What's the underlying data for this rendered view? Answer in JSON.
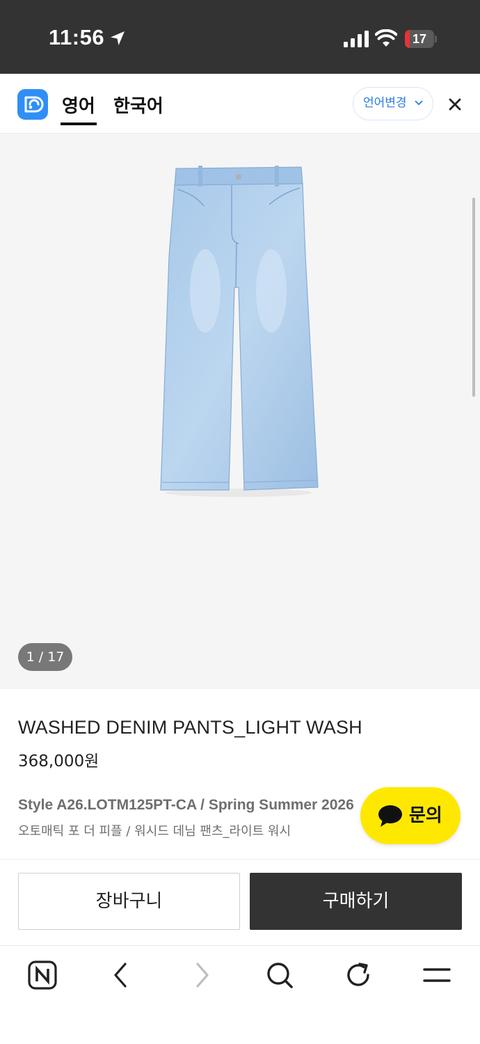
{
  "status_bar": {
    "time": "11:56",
    "battery_level": "17",
    "battery_fraction": 0.17,
    "battery_color": "#e5333b",
    "icons": [
      "location-arrow-icon",
      "cellular-signal-icon",
      "wifi-icon",
      "battery-icon"
    ]
  },
  "translate_bar": {
    "tabs": [
      {
        "label": "영어",
        "active": true
      },
      {
        "label": "한국어",
        "active": false
      }
    ],
    "change_language_label": "언어변경",
    "accent_color": "#2c7be5",
    "icons": [
      "translate-app-logo-icon",
      "chevron-down-icon",
      "close-icon"
    ]
  },
  "gallery": {
    "counter": "1 / 17",
    "current": 1,
    "total": 17
  },
  "product": {
    "name": "WASHED DENIM PANTS_LIGHT WASH",
    "price": "368,000원",
    "style_line": "Style A26.LOTM125PT-CA / Spring Summer 2026",
    "korean_name": "오토매틱 포 더 피플 / 워시드 데님 팬츠_라이트 워시"
  },
  "inquiry": {
    "label": "문의",
    "color": "#ffe800"
  },
  "actions": {
    "cart_label": "장바구니",
    "buy_label": "구매하기"
  },
  "browser_toolbar": {
    "icons": [
      "naver-home-icon",
      "back-icon",
      "forward-icon",
      "search-icon",
      "refresh-icon",
      "menu-icon"
    ]
  }
}
